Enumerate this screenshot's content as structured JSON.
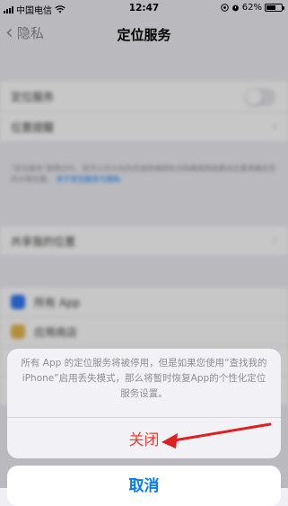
{
  "status_bar": {
    "carrier": "中国电信",
    "time": "12:47",
    "battery": "62%",
    "battery_level": 0.62
  },
  "nav": {
    "back_label": "隐私",
    "title": "定位服务"
  },
  "background_list": {
    "toggle_row": "定位服务",
    "alerts_row": "位置提醒",
    "description": "\"定位服务\"使用GPS、蓝牙以及众包的无线局域网热点和蜂窝网络基站位置来确定您的大致位置。",
    "description_link": "关于定位服务与隐私",
    "share_row": "共享我的位置",
    "app_rows": [
      {
        "label": "所有 App",
        "color": "#3478f6"
      },
      {
        "label": "应用商店",
        "color": "#e5b84c"
      },
      {
        "label": "日历",
        "color": "#6c7bd6"
      }
    ]
  },
  "action_sheet": {
    "message": "所有 App 的定位服务将被停用，但是如果您使用“查找我的 iPhone”启用丢失模式，那么将暂时恢复App的个性化定位服务设置。",
    "close_label": "关闭",
    "cancel_label": "取消"
  },
  "colors": {
    "destructive": "#ff3b30",
    "link": "#007aff",
    "annotation_arrow": "#e02020"
  },
  "icons": [
    "back-chevron-icon",
    "wifi-icon",
    "signal-icon",
    "battery-icon",
    "alarm-icon",
    "location-lock-icon"
  ]
}
